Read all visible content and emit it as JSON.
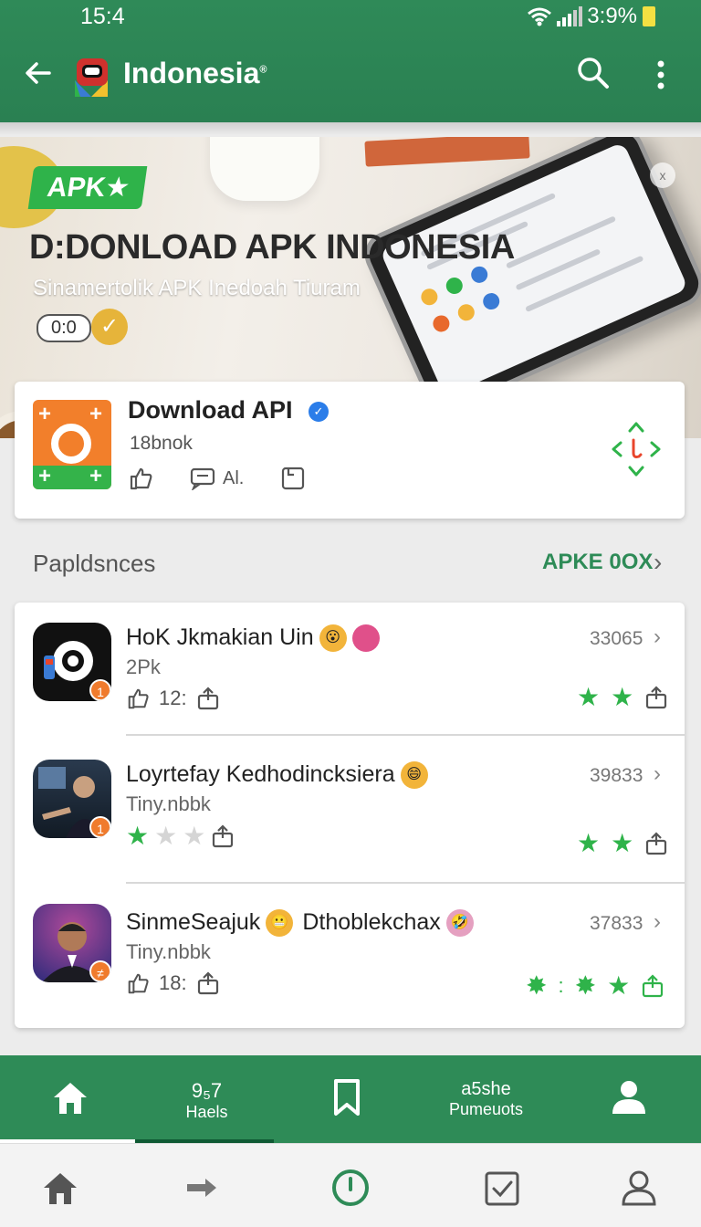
{
  "status": {
    "time": "15:4",
    "battery": "3:9%"
  },
  "appbar": {
    "title": "Indonesia",
    "trademark": "®"
  },
  "hero": {
    "badge": "APK★",
    "headline": "D:DONLOAD APK INDONESIA",
    "subline": "Sinamertolik APK Inedoah Tiuram",
    "pill": "0:0",
    "close": "x"
  },
  "featured": {
    "title": "Download API",
    "subtitle": "18bnok",
    "action_label": "Al."
  },
  "section": {
    "title": "Papldsnces",
    "link": "APKE 0OX"
  },
  "list": [
    {
      "name": "HoK Jkmakian Uin",
      "sub": "2Pk",
      "count": "33065",
      "meta_num": "12:",
      "badge": "1",
      "stars": [
        1,
        1
      ],
      "stars_label": ""
    },
    {
      "name": "Loyrtefay Kedhodincksiera",
      "sub": "Tiny.nbbk",
      "count": "39833",
      "meta_num": "",
      "badge": "1",
      "stars": [
        1,
        1
      ],
      "stars_label": ""
    },
    {
      "name": "SinmeSeajuk",
      "name2": "Dthoblekchax",
      "sub": "Tiny.nbbk",
      "count": "37833",
      "meta_num": "18:",
      "badge": "≠",
      "stars": [
        1,
        1,
        1
      ],
      "stars_label": ""
    }
  ],
  "nav_primary": [
    {
      "icon": "home-icon"
    },
    {
      "label1": "9₅7",
      "label2": "Haels"
    },
    {
      "icon": "bookmark-icon"
    },
    {
      "label1": "a5she",
      "label2": "Pumeuots"
    },
    {
      "icon": "person-icon"
    }
  ],
  "nav_secondary": [
    {
      "icon": "home-icon"
    },
    {
      "icon": "arrow-right-icon"
    },
    {
      "icon": "power-circle-icon"
    },
    {
      "icon": "check-box-icon"
    },
    {
      "icon": "user-outline-icon"
    }
  ],
  "colors": {
    "primary": "#2e8b57",
    "accent": "#2fb34a",
    "orange": "#f07b2d"
  }
}
